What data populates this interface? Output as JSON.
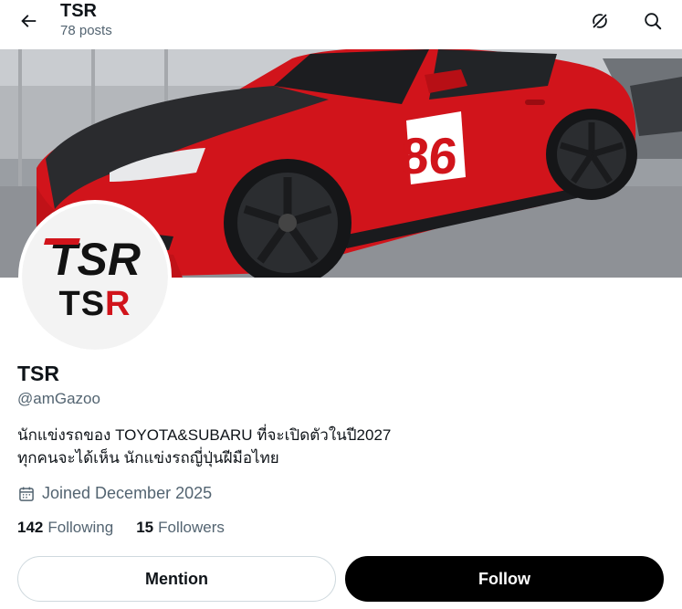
{
  "header": {
    "title": "TSR",
    "subtitle": "78 posts",
    "back_icon": "arrow-left-icon",
    "grok_icon": "grok-icon",
    "search_icon": "search-icon"
  },
  "banner": {
    "race_number": "86"
  },
  "avatar": {
    "logo_top": "TSR",
    "logo_bottom": "TSR",
    "logo_bottom_tail": "R"
  },
  "profile": {
    "name": "TSR",
    "handle": "@amGazoo",
    "bio_line1": "นักแข่งรถของ TOYOTA&SUBARU ที่จะเปิดตัวในปี2027",
    "bio_line2": "ทุกคนจะได้เห็น นักแข่งรถญี่ปุ่นฝีมือไทย",
    "joined": "Joined December 2025",
    "following_count": "142",
    "following_label": "Following",
    "followers_count": "15",
    "followers_label": "Followers"
  },
  "actions": {
    "mention_label": "Mention",
    "follow_label": "Follow"
  },
  "colors": {
    "car_red": "#d1141b",
    "text_primary": "#0f1419",
    "text_secondary": "#536471",
    "follow_bg": "#000000"
  }
}
